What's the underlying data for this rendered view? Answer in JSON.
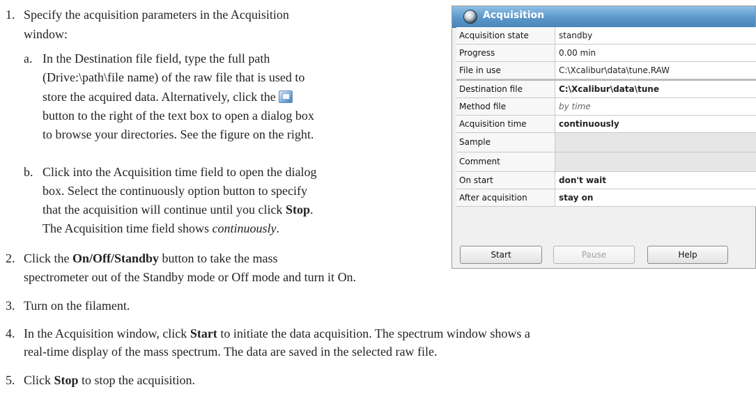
{
  "instructions": {
    "step1": {
      "num": "1.",
      "line1": "Specify the acquisition parameters in the Acquisition",
      "line2": "window:",
      "a": {
        "label": "a.",
        "line1": "In the Destination file field, type the full path",
        "line2": "(Drive:\\path\\file name) of the raw file that is used to",
        "line3_pre": "store the acquired data. Alternatively, click the",
        "line4": "button to the right of the text box to open a dialog box",
        "line5": "to browse your directories. See the figure on the right."
      },
      "b": {
        "label": "b.",
        "line1": "Click into the Acquisition time field to open the dialog",
        "line2": "box. Select the continuously option button to specify",
        "line3_pre": "that the acquisition will continue until you click ",
        "line3_bold": "Stop",
        "line3_post": ".",
        "line4_pre": "The Acquisition time field shows ",
        "line4_ital": "continuously",
        "line4_post": "."
      }
    },
    "step2": {
      "num": "2.",
      "line1_pre": "Click the ",
      "line1_bold": "On/Off/Standby",
      "line1_post": " button to take the mass",
      "line2": "spectrometer out of the Standby mode or Off mode and turn it On."
    },
    "step3": {
      "num": "3.",
      "text": "Turn on the filament."
    },
    "step4": {
      "num": "4.",
      "line1_pre": "In the Acquisition window, click ",
      "line1_bold": "Start",
      "line1_post": " to initiate the data acquisition. The spectrum window shows a",
      "line2": "real-time display of the mass spectrum. The data are saved in the selected raw file."
    },
    "step5": {
      "num": "5.",
      "pre": "Click ",
      "bold": "Stop",
      "post": " to stop the acquisition."
    },
    "browse_icon": "browse-file-icon"
  },
  "panel": {
    "title": "Acquisition",
    "header_icon": "acquisition-icon",
    "rows": [
      {
        "label": "Acquisition state",
        "value": "standby"
      },
      {
        "label": "Progress",
        "value": "0.00 min"
      },
      {
        "label": "File in use",
        "value": "C:\\Xcalibur\\data\\tune.RAW"
      },
      {
        "label": "Destination file",
        "value": "C:\\Xcalibur\\data\\tune"
      },
      {
        "label": "Method file",
        "value": "by time"
      },
      {
        "label": "Acquisition time",
        "value": "continuously"
      },
      {
        "label": "Sample",
        "value": ""
      },
      {
        "label": "Comment",
        "value": ""
      },
      {
        "label": "On start",
        "value": "don't wait"
      },
      {
        "label": "After acquisition",
        "value": "stay on"
      }
    ],
    "buttons": {
      "start": "Start",
      "pause": "Pause",
      "help": "Help"
    },
    "colors": {
      "header": "#5b97c9",
      "row_border": "#c9c9c9"
    }
  }
}
